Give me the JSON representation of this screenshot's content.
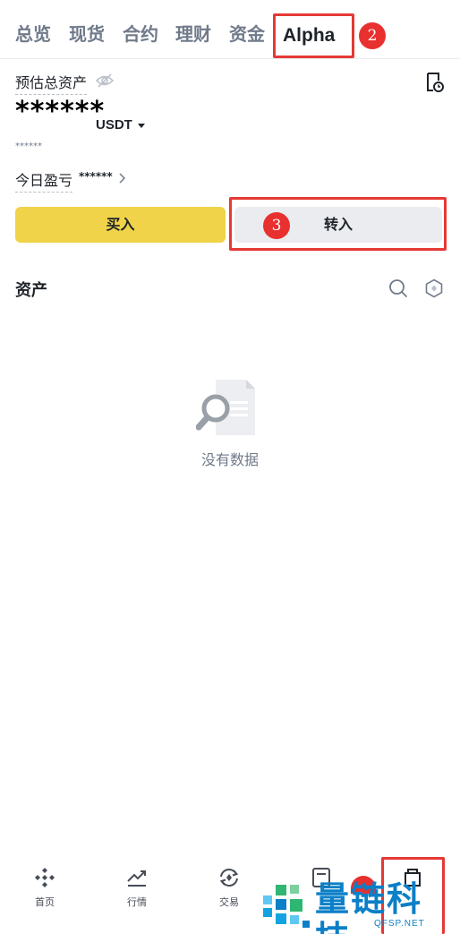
{
  "tabs": [
    {
      "label": "总览"
    },
    {
      "label": "现货"
    },
    {
      "label": "合约"
    },
    {
      "label": "理财"
    },
    {
      "label": "资金"
    },
    {
      "label": "Alpha",
      "active": true
    }
  ],
  "annotations": {
    "step2": "2",
    "step3": "3"
  },
  "account": {
    "estimated_total_label": "预估总资产",
    "balance_masked": "******",
    "currency": "USDT",
    "sub_value_masked": "******",
    "today_pnl_label": "今日盈亏",
    "today_pnl_masked": "******"
  },
  "actions": {
    "buy_label": "买入",
    "transfer_in_label": "转入"
  },
  "assets": {
    "title": "资产",
    "empty_text": "没有数据"
  },
  "bottom_nav": [
    {
      "label": "首页",
      "icon": "binance-logo-icon"
    },
    {
      "label": "行情",
      "icon": "market-chart-icon"
    },
    {
      "label": "交易",
      "icon": "trade-exchange-icon"
    },
    {
      "label": "",
      "icon": "futures-icon"
    },
    {
      "label": "",
      "icon": "wallet-icon",
      "active": true
    }
  ],
  "watermark": {
    "brand": "量链科技",
    "domain": "QFSP.NET"
  },
  "colors": {
    "accent": "#f0d348",
    "annotation_red": "#e8302f",
    "watermark_blue": "#0b7fc7"
  }
}
